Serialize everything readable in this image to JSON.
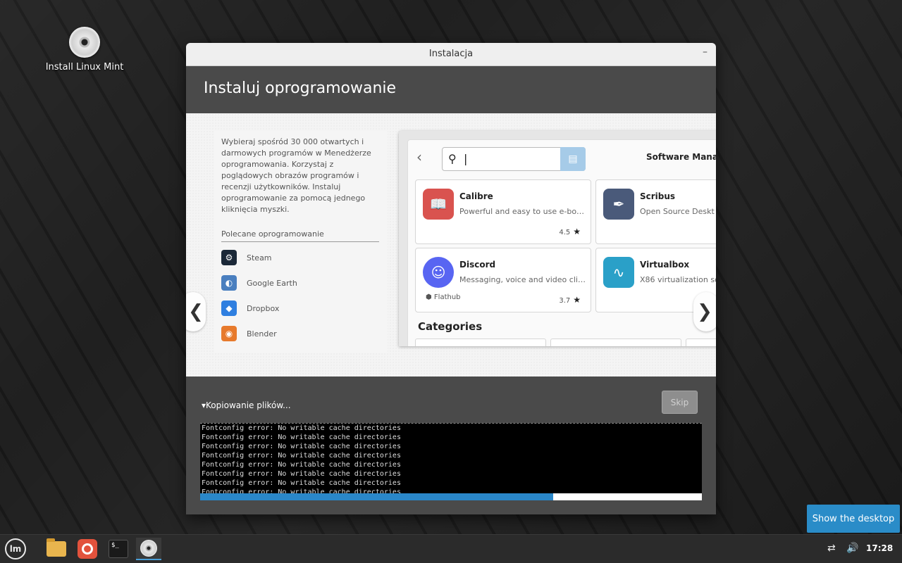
{
  "desktop": {
    "icon_label": "Install Linux Mint"
  },
  "window": {
    "title": "Instalacja",
    "minimize_glyph": "–",
    "header_title": "Instaluj oprogramowanie"
  },
  "slide": {
    "description": "Wybieraj spośród 30 000 otwartych i darmowych programów w Menedżerze oprogramowania. Korzystaj z poglądowych obrazów programów i recenzji użytkowników. Instaluj oprogramowanie za pomocą jednego kliknięcia myszki.",
    "recommended_title": "Polecane oprogramowanie",
    "recommended": [
      {
        "label": "Steam",
        "icon": "steam-icon",
        "color": "#1b2838"
      },
      {
        "label": "Google Earth",
        "icon": "google-earth-icon",
        "color": "#4a7fbf"
      },
      {
        "label": "Dropbox",
        "icon": "dropbox-icon",
        "color": "#2f7fe0"
      },
      {
        "label": "Blender",
        "icon": "blender-icon",
        "color": "#e77a2c"
      }
    ],
    "nav_prev": "❮",
    "nav_next": "❯"
  },
  "software_manager": {
    "title": "Software Manag",
    "search_value": "",
    "apps": [
      {
        "name": "Calibre",
        "desc": "Powerful and easy to use e-bo…",
        "rating": "4.5",
        "icon": "calibre-icon",
        "color": "#d9534f"
      },
      {
        "name": "Scribus",
        "desc": "Open Source Deskt",
        "icon": "scribus-icon",
        "color": "#4a5a7a"
      },
      {
        "name": "Discord",
        "desc": "Messaging, voice and video cli…",
        "rating": "3.7",
        "source": "Flathub",
        "icon": "discord-icon",
        "color": "#5865f2"
      },
      {
        "name": "Virtualbox",
        "desc": "X86 virtualization so",
        "icon": "virtualbox-icon",
        "color": "#2aa0c8"
      }
    ],
    "categories_label": "Categories"
  },
  "progress": {
    "status_label": "Kopiowanie plików...",
    "skip_label": "Skip",
    "fraction": 0.703,
    "terminal_lines": [
      "Fontconfig error: No writable cache directories",
      "Fontconfig error: No writable cache directories",
      "Fontconfig error: No writable cache directories",
      "Fontconfig error: No writable cache directories",
      "Fontconfig error: No writable cache directories",
      "Fontconfig error: No writable cache directories",
      "Fontconfig error: No writable cache directories",
      "Fontconfig error: No writable cache directories"
    ]
  },
  "show_desktop_label": "Show the desktop",
  "taskbar": {
    "clock": "17:28",
    "items": [
      "mint-menu-icon",
      "files-icon",
      "firefox-icon",
      "terminal-icon",
      "installer-icon"
    ]
  },
  "colors": {
    "accent": "#2a87c9",
    "window_dark": "#4a4a4a"
  }
}
